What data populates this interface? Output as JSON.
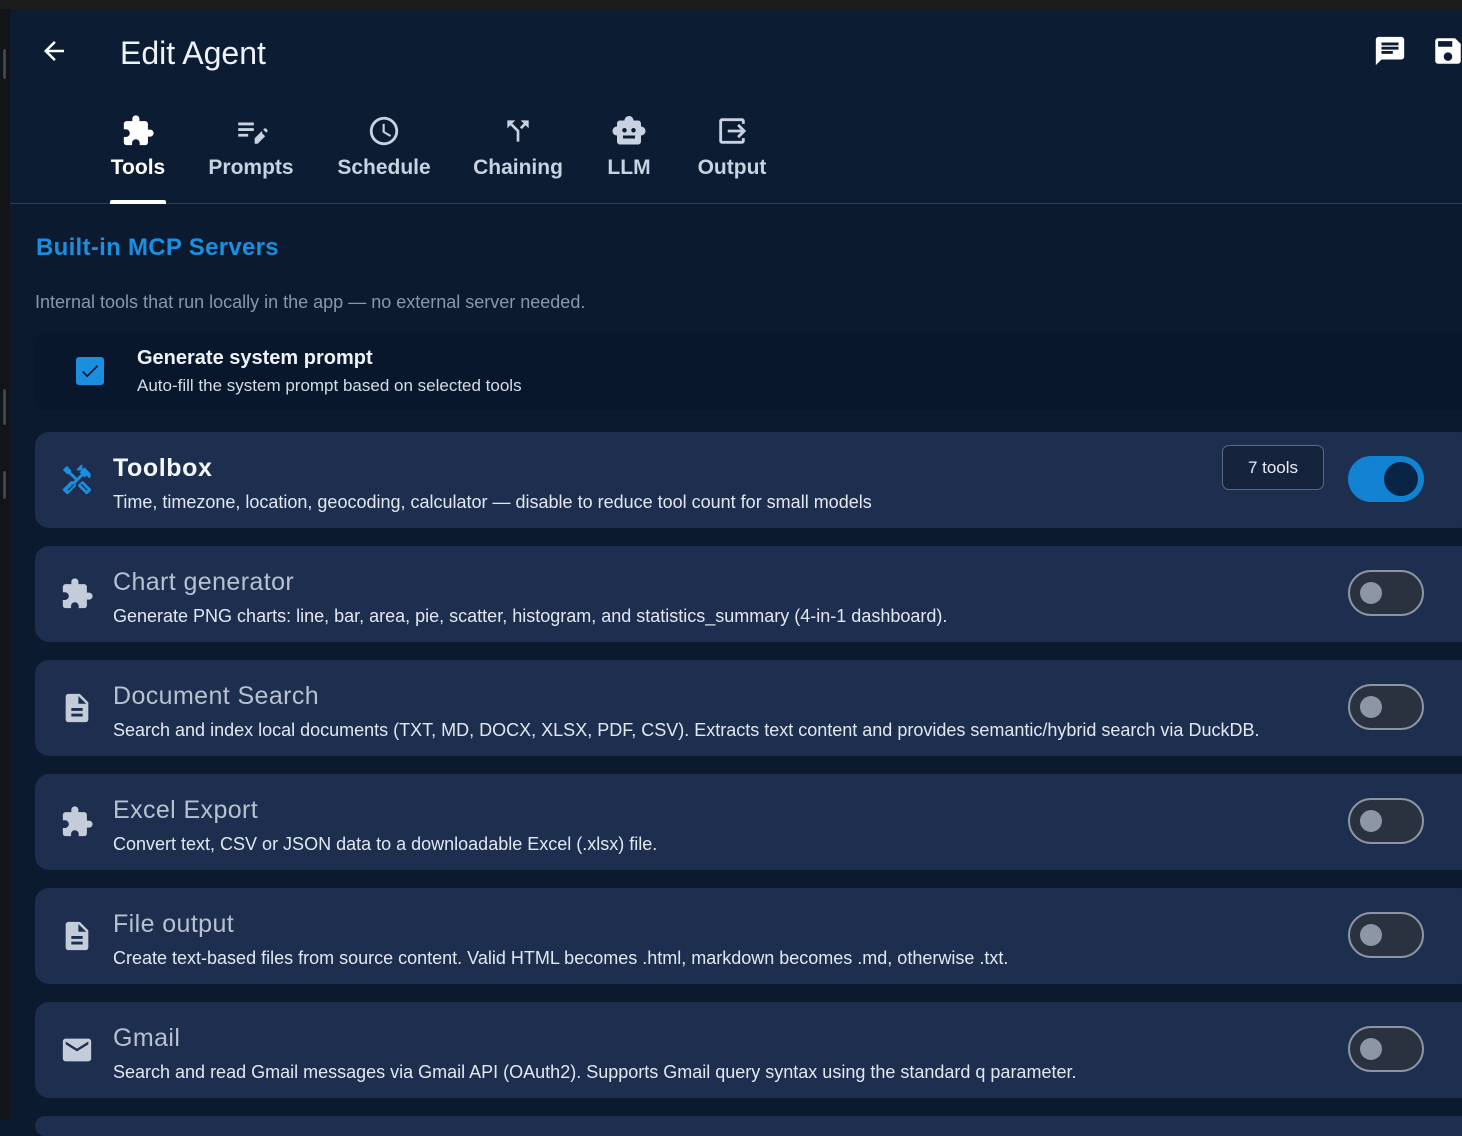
{
  "header": {
    "title": "Edit Agent"
  },
  "tabs": [
    {
      "label": "Tools",
      "icon": "puzzle-icon",
      "active": true
    },
    {
      "label": "Prompts",
      "icon": "edit-note-icon",
      "active": false
    },
    {
      "label": "Schedule",
      "icon": "clock-icon",
      "active": false
    },
    {
      "label": "Chaining",
      "icon": "merge-icon",
      "active": false
    },
    {
      "label": "LLM",
      "icon": "robot-icon",
      "active": false
    },
    {
      "label": "Output",
      "icon": "output-icon",
      "active": false
    }
  ],
  "section": {
    "title": "Built-in MCP Servers",
    "description": "Internal tools that run locally in the app — no external server needed."
  },
  "generate_prompt": {
    "title": "Generate system prompt",
    "subtitle": "Auto-fill the system prompt based on selected tools",
    "checked": true
  },
  "servers": [
    {
      "name": "Toolbox",
      "description": "Time, timezone, location, geocoding, calculator — disable to reduce tool count for small models",
      "icon": "tools-icon",
      "enabled": true,
      "badge": "7 tools"
    },
    {
      "name": "Chart generator",
      "description": "Generate PNG charts: line, bar, area, pie, scatter, histogram, and statistics_summary (4-in-1 dashboard).",
      "icon": "puzzle-icon",
      "enabled": false
    },
    {
      "name": "Document Search",
      "description": "Search and index local documents (TXT, MD, DOCX, XLSX, PDF, CSV). Extracts text content and provides semantic/hybrid search via DuckDB.",
      "icon": "document-icon",
      "enabled": false
    },
    {
      "name": "Excel Export",
      "description": "Convert text, CSV or JSON data to a downloadable Excel (.xlsx) file.",
      "icon": "puzzle-icon",
      "enabled": false
    },
    {
      "name": "File output",
      "description": "Create text-based files from source content. Valid HTML becomes .html, markdown becomes .md, otherwise .txt.",
      "icon": "document-icon",
      "enabled": false
    },
    {
      "name": "Gmail",
      "description": "Search and read Gmail messages via Gmail API (OAuth2). Supports Gmail query syntax using the standard q parameter.",
      "icon": "mail-icon",
      "enabled": false
    }
  ],
  "colors": {
    "accent": "#1a8fe0",
    "background": "#0b1a2f",
    "card": "#1d2e4f",
    "switch_on": "#1283d3"
  }
}
